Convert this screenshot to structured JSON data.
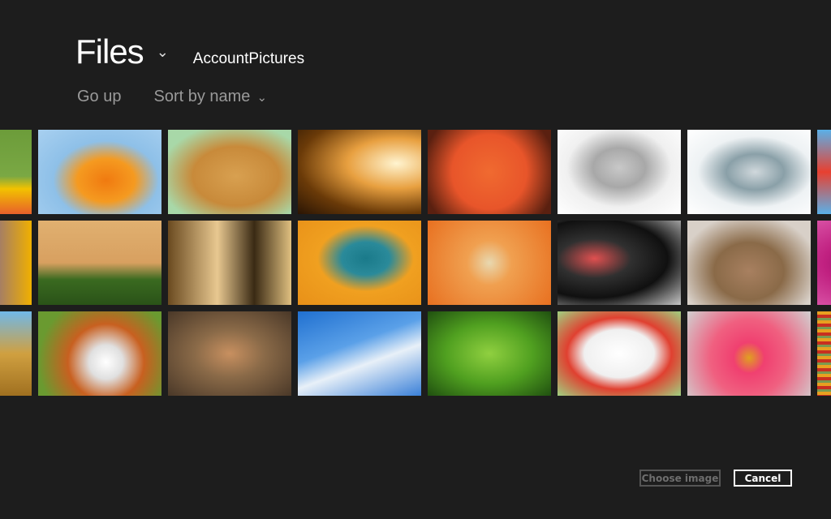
{
  "header": {
    "title": "Files",
    "title_chevron_icon": "chevron-down-icon",
    "folder": "AccountPictures"
  },
  "toolbar": {
    "go_up": "Go up",
    "sort": "Sort by name",
    "sort_chevron_icon": "chevron-down-icon"
  },
  "grid": {
    "rows": [
      [
        "yellow flower (partial)",
        "goldfish",
        "golden retriever puppy",
        "golden sparkling lights",
        "red starfish",
        "white robot toy",
        "gyroscope",
        "airplane (partial)"
      ],
      [
        "purple fish (partial)",
        "bonsai tree",
        "chess pieces",
        "bass clef",
        "sand starfish",
        "vinyl record player",
        "sleeping kitten",
        "pink tulip (partial)"
      ],
      [
        "brass gears (partial)",
        "sports balls",
        "tabby kitten",
        "roller coaster",
        "green leaf",
        "lucky cat figurine",
        "pink gerbera daisy",
        "striped yarn (partial)"
      ]
    ]
  },
  "actions": {
    "choose": "Choose image",
    "cancel": "Cancel"
  },
  "colors": {
    "background": "#1d1d1d",
    "text_primary": "#ffffff",
    "text_secondary": "#9a9a9a",
    "disabled": "#555555"
  }
}
